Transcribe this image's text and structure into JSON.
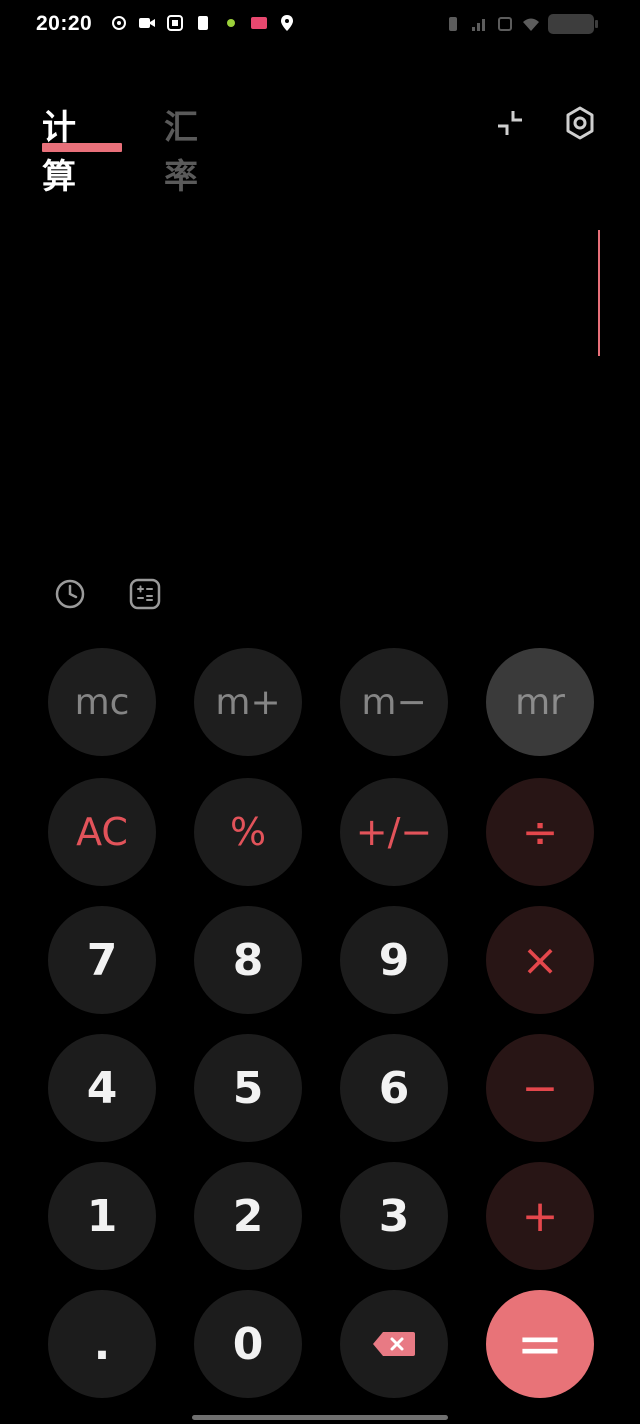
{
  "status_bar": {
    "time": "20:20"
  },
  "tabs": [
    {
      "label": "计算",
      "active": true
    },
    {
      "label": "汇率",
      "active": false
    }
  ],
  "colors": {
    "accent": "#e8707a",
    "operator_text": "#e4474c",
    "operator_bg": "#281515",
    "key_bg": "#1c1c1c",
    "background": "#000000"
  },
  "icons": {
    "collapse": "collapse-icon",
    "settings": "settings-icon",
    "history": "history-icon",
    "converter": "unit-converter-icon",
    "backspace": "backspace-icon"
  },
  "keys": {
    "mc": "mc",
    "m_plus": "m+",
    "m_minus": "m−",
    "mr": "mr",
    "ac": "AC",
    "percent": "%",
    "plus_minus": "+/−",
    "divide": "÷",
    "seven": "7",
    "eight": "8",
    "nine": "9",
    "multiply": "×",
    "four": "4",
    "five": "5",
    "six": "6",
    "minus": "−",
    "one": "1",
    "two": "2",
    "three": "3",
    "plus": "+",
    "dot": ".",
    "zero": "0",
    "equals": "="
  }
}
